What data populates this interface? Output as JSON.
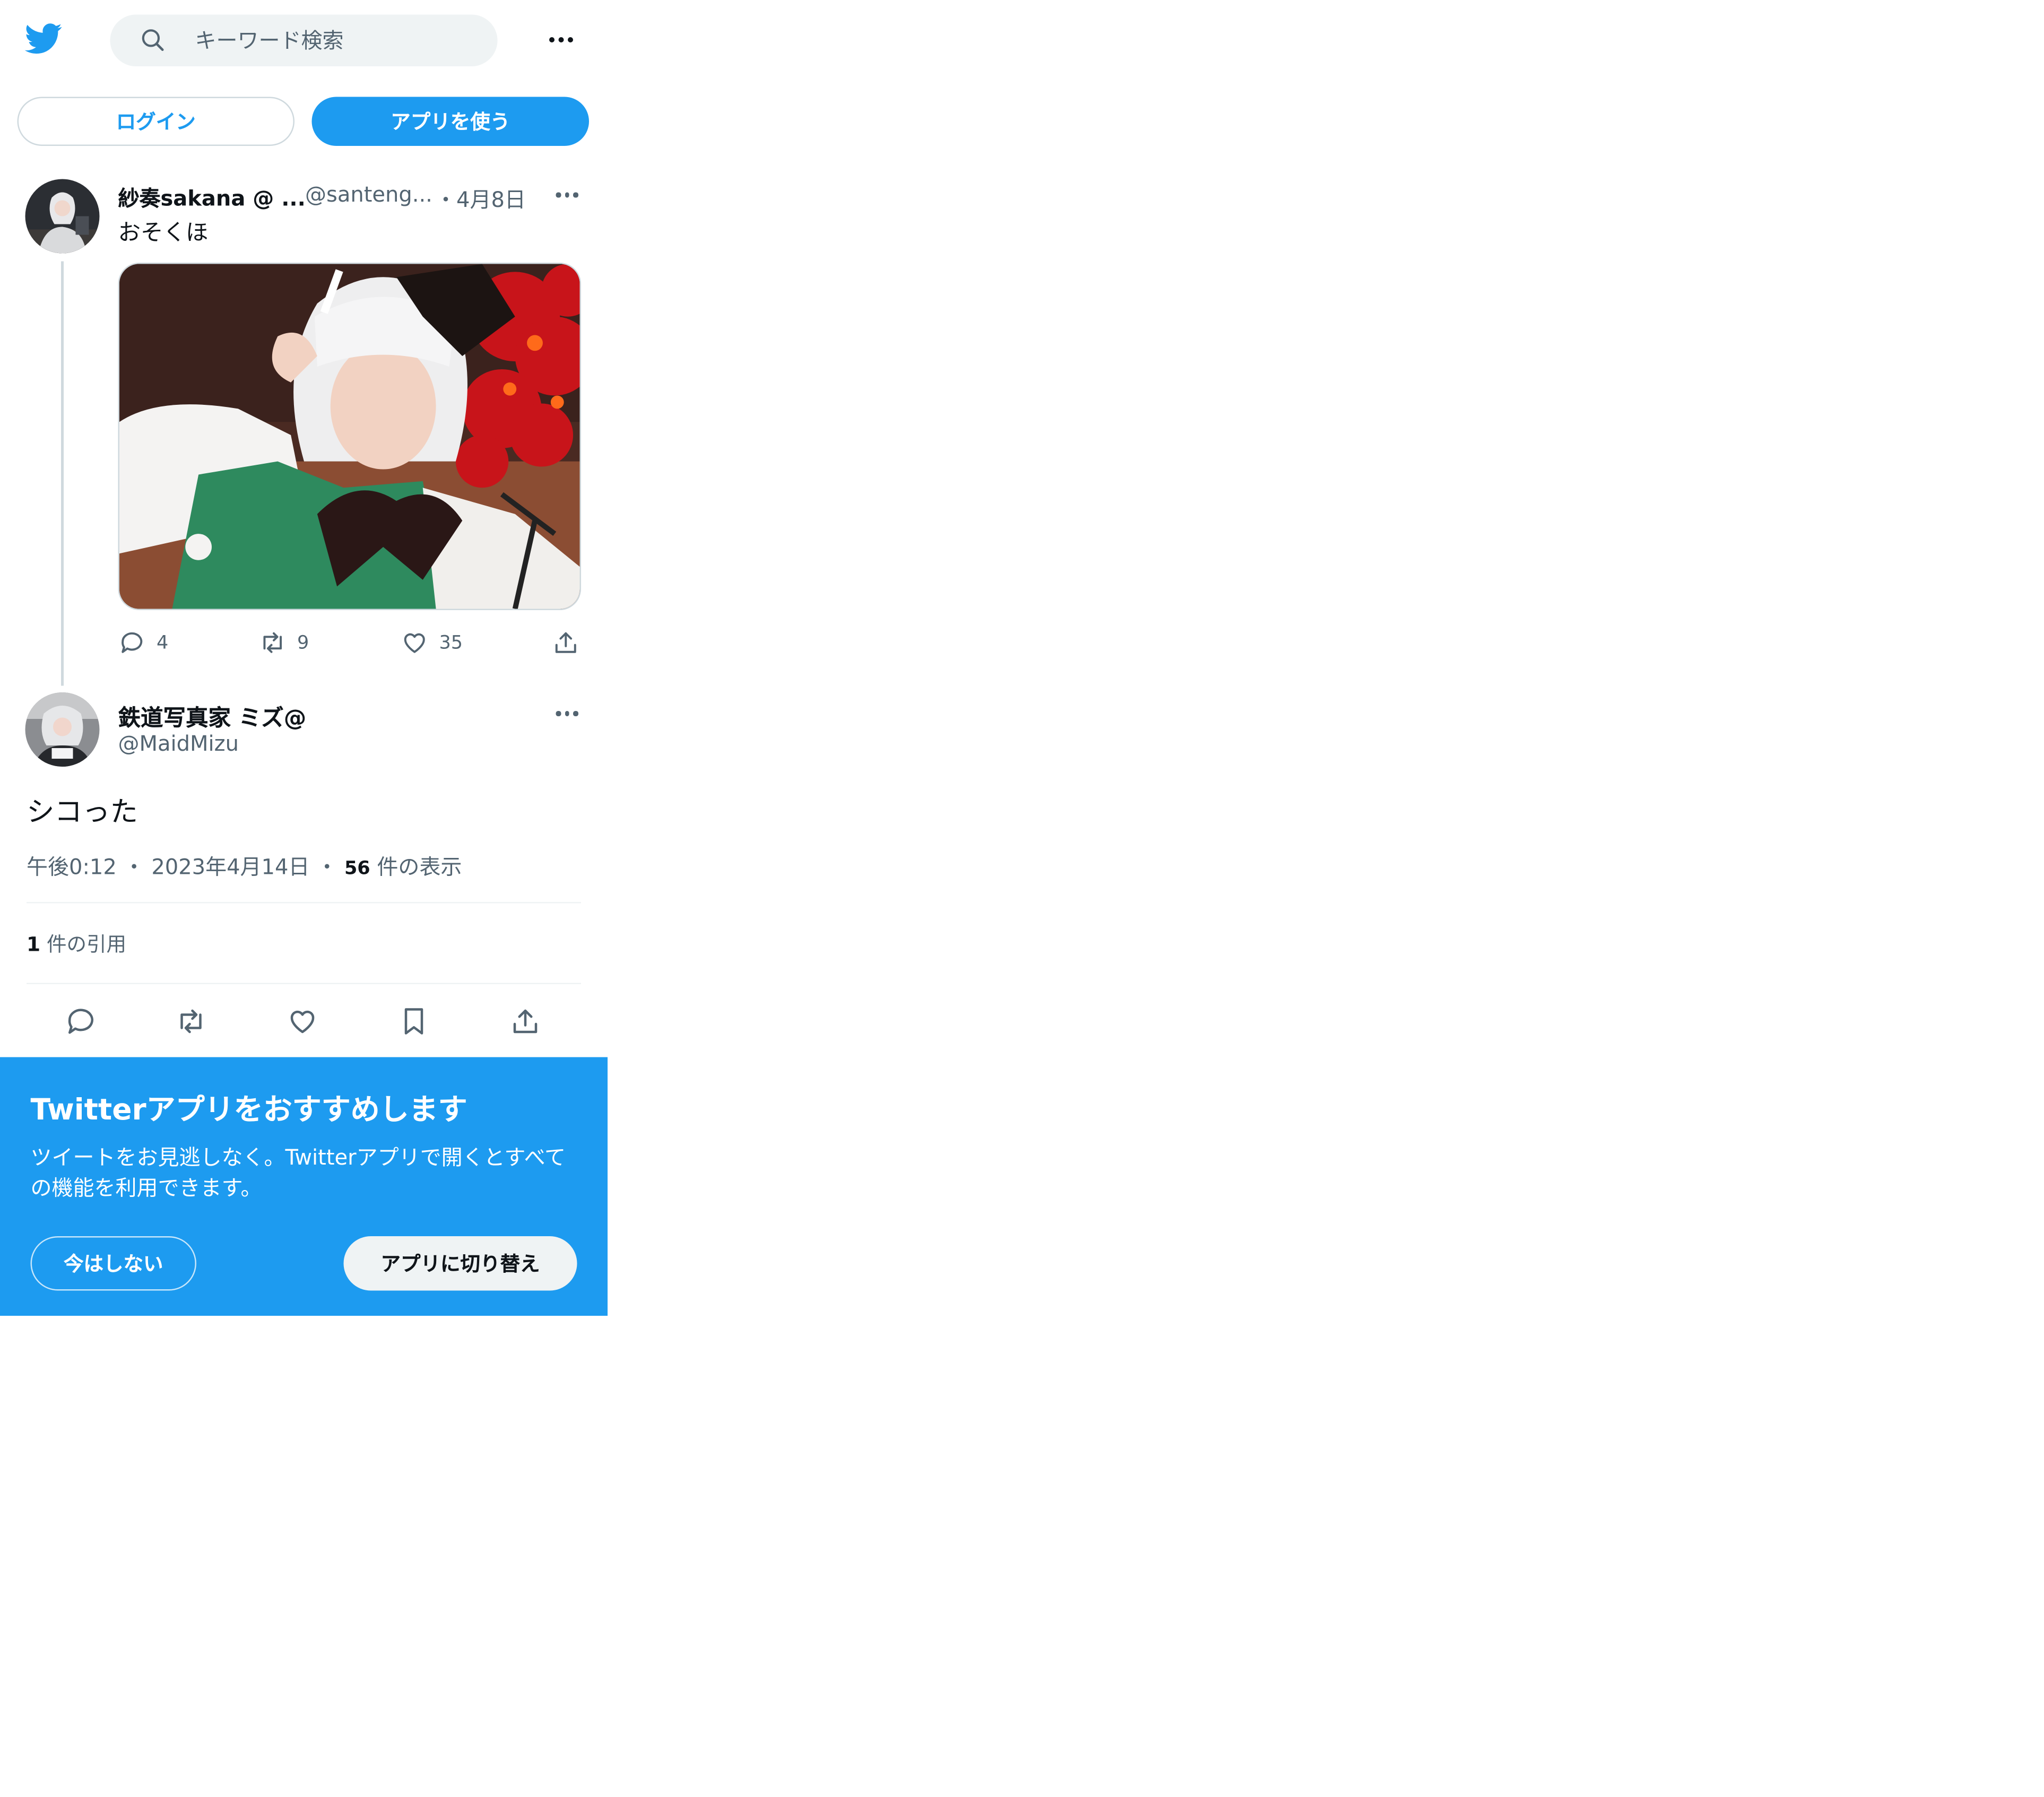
{
  "colors": {
    "accent": "#1d9bf0",
    "text": "#0f1419",
    "secondary": "#536471",
    "border": "#cfd9de"
  },
  "header": {
    "logo_icon": "twitter-bird-icon",
    "search_placeholder": "キーワード検索",
    "more_icon": "more-horizontal-icon"
  },
  "auth": {
    "login_label": "ログイン",
    "app_label": "アプリを使う"
  },
  "parent_tweet": {
    "name": "紗奏sakana @ ...",
    "handle": "@santeng...",
    "date": "・4月8日",
    "text": "おそくほ",
    "media_icon": "photo-cosplay",
    "reply_count": "4",
    "retweet_count": "9",
    "like_count": "35"
  },
  "main_tweet": {
    "name": "鉄道写真家 ミズ@",
    "handle": "@MaidMizu",
    "text": "シコった",
    "time": "午後0:12",
    "date": "2023年4月14日",
    "views_count": "56",
    "views_label": "件の表示",
    "quotes_count": "1",
    "quotes_label": "件の引用"
  },
  "banner": {
    "title": "Twitterアプリをおすすめします",
    "text": "ツイートをお見逃しなく。Twitterアプリで開くとすべての機能を利用できます。",
    "not_now_label": "今はしない",
    "switch_label": "アプリに切り替え"
  }
}
